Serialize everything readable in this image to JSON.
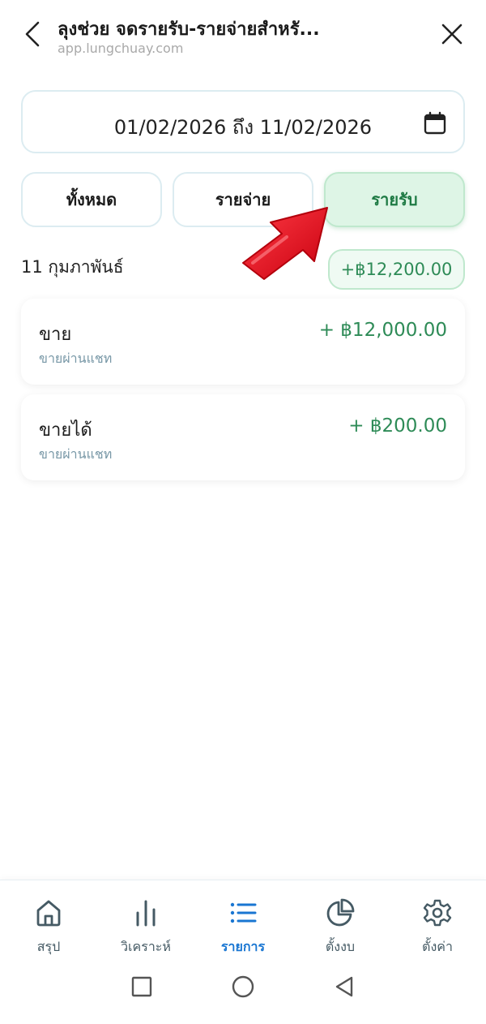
{
  "header": {
    "title": "ลุงช่วย จดรายรับ-รายจ่ายสำหรั...",
    "url": "app.lungchuay.com"
  },
  "date_range": {
    "label": "01/02/2026 ถึง 11/02/2026"
  },
  "filters": {
    "all": "ทั้งหมด",
    "expense": "รายจ่าย",
    "income": "รายรับ",
    "selected": "income"
  },
  "groups": [
    {
      "date": "11 กุมภาพันธ์",
      "total": "+฿12,200.00",
      "items": [
        {
          "name": "ขาย",
          "sub": "ขายผ่านแชท",
          "amount": "+ ฿12,000.00"
        },
        {
          "name": "ขายได้",
          "sub": "ขายผ่านแชท",
          "amount": "+ ฿200.00"
        }
      ]
    }
  ],
  "bottom_nav": [
    {
      "label": "สรุป",
      "icon": "home-icon"
    },
    {
      "label": "วิเคราะห์",
      "icon": "bar-chart-icon"
    },
    {
      "label": "รายการ",
      "icon": "list-icon",
      "active": true
    },
    {
      "label": "ตั้งงบ",
      "icon": "pie-chart-icon"
    },
    {
      "label": "ตั้งค่า",
      "icon": "gear-icon"
    }
  ],
  "colors": {
    "income_green": "#2e8b57",
    "active_blue": "#1976d2",
    "arrow_red": "#e0101e"
  }
}
